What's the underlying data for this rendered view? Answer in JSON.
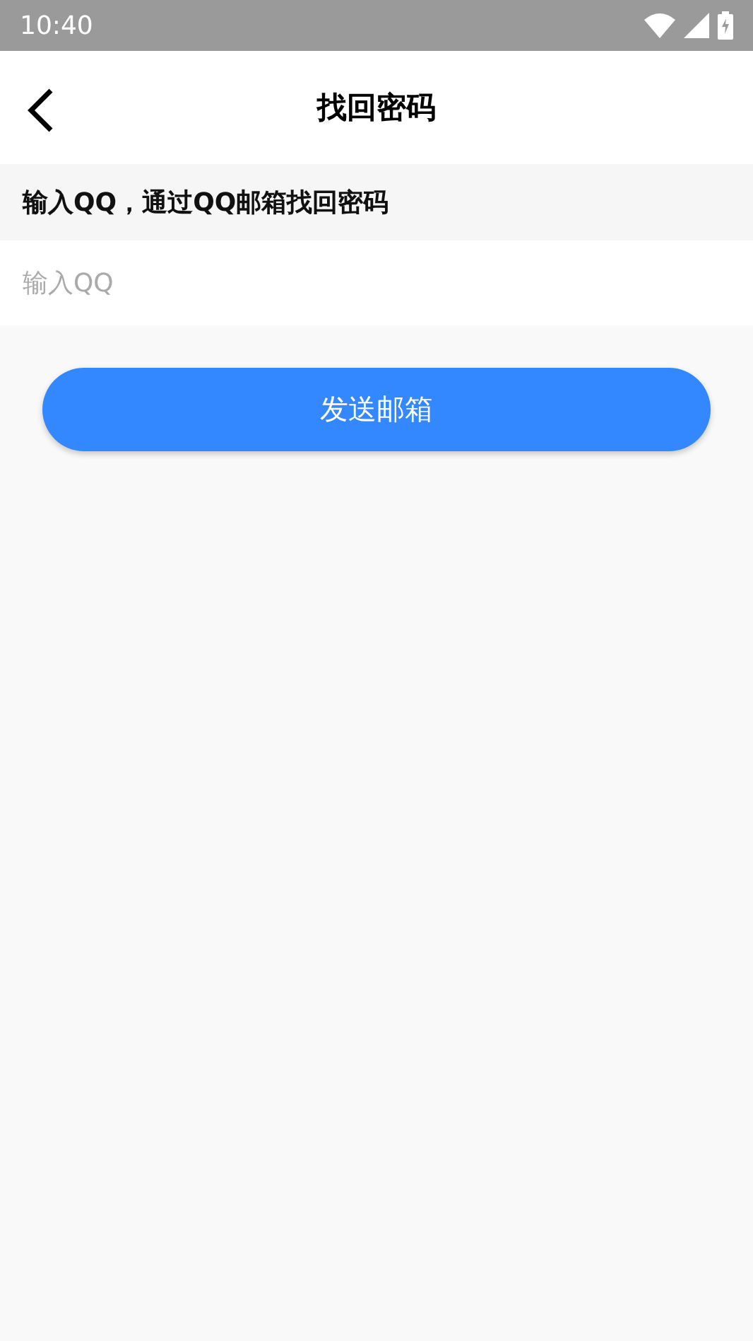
{
  "status_bar": {
    "time": "10:40"
  },
  "header": {
    "title": "找回密码"
  },
  "hint": "输入QQ，通过QQ邮箱找回密码",
  "qq_field": {
    "placeholder": "输入QQ"
  },
  "submit_button": "发送邮箱"
}
